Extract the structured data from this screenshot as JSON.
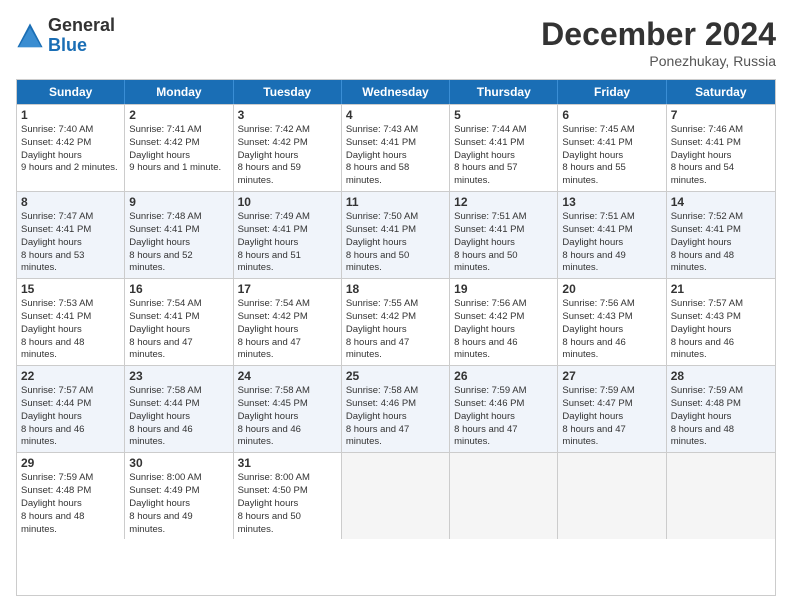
{
  "logo": {
    "general": "General",
    "blue": "Blue"
  },
  "title": "December 2024",
  "location": "Ponezhukay, Russia",
  "days_of_week": [
    "Sunday",
    "Monday",
    "Tuesday",
    "Wednesday",
    "Thursday",
    "Friday",
    "Saturday"
  ],
  "weeks": [
    [
      {
        "day": 1,
        "sunrise": "7:40 AM",
        "sunset": "4:42 PM",
        "daylight": "9 hours and 2 minutes."
      },
      {
        "day": 2,
        "sunrise": "7:41 AM",
        "sunset": "4:42 PM",
        "daylight": "9 hours and 1 minute."
      },
      {
        "day": 3,
        "sunrise": "7:42 AM",
        "sunset": "4:42 PM",
        "daylight": "8 hours and 59 minutes."
      },
      {
        "day": 4,
        "sunrise": "7:43 AM",
        "sunset": "4:41 PM",
        "daylight": "8 hours and 58 minutes."
      },
      {
        "day": 5,
        "sunrise": "7:44 AM",
        "sunset": "4:41 PM",
        "daylight": "8 hours and 57 minutes."
      },
      {
        "day": 6,
        "sunrise": "7:45 AM",
        "sunset": "4:41 PM",
        "daylight": "8 hours and 55 minutes."
      },
      {
        "day": 7,
        "sunrise": "7:46 AM",
        "sunset": "4:41 PM",
        "daylight": "8 hours and 54 minutes."
      }
    ],
    [
      {
        "day": 8,
        "sunrise": "7:47 AM",
        "sunset": "4:41 PM",
        "daylight": "8 hours and 53 minutes."
      },
      {
        "day": 9,
        "sunrise": "7:48 AM",
        "sunset": "4:41 PM",
        "daylight": "8 hours and 52 minutes."
      },
      {
        "day": 10,
        "sunrise": "7:49 AM",
        "sunset": "4:41 PM",
        "daylight": "8 hours and 51 minutes."
      },
      {
        "day": 11,
        "sunrise": "7:50 AM",
        "sunset": "4:41 PM",
        "daylight": "8 hours and 50 minutes."
      },
      {
        "day": 12,
        "sunrise": "7:51 AM",
        "sunset": "4:41 PM",
        "daylight": "8 hours and 50 minutes."
      },
      {
        "day": 13,
        "sunrise": "7:51 AM",
        "sunset": "4:41 PM",
        "daylight": "8 hours and 49 minutes."
      },
      {
        "day": 14,
        "sunrise": "7:52 AM",
        "sunset": "4:41 PM",
        "daylight": "8 hours and 48 minutes."
      }
    ],
    [
      {
        "day": 15,
        "sunrise": "7:53 AM",
        "sunset": "4:41 PM",
        "daylight": "8 hours and 48 minutes."
      },
      {
        "day": 16,
        "sunrise": "7:54 AM",
        "sunset": "4:41 PM",
        "daylight": "8 hours and 47 minutes."
      },
      {
        "day": 17,
        "sunrise": "7:54 AM",
        "sunset": "4:42 PM",
        "daylight": "8 hours and 47 minutes."
      },
      {
        "day": 18,
        "sunrise": "7:55 AM",
        "sunset": "4:42 PM",
        "daylight": "8 hours and 47 minutes."
      },
      {
        "day": 19,
        "sunrise": "7:56 AM",
        "sunset": "4:42 PM",
        "daylight": "8 hours and 46 minutes."
      },
      {
        "day": 20,
        "sunrise": "7:56 AM",
        "sunset": "4:43 PM",
        "daylight": "8 hours and 46 minutes."
      },
      {
        "day": 21,
        "sunrise": "7:57 AM",
        "sunset": "4:43 PM",
        "daylight": "8 hours and 46 minutes."
      }
    ],
    [
      {
        "day": 22,
        "sunrise": "7:57 AM",
        "sunset": "4:44 PM",
        "daylight": "8 hours and 46 minutes."
      },
      {
        "day": 23,
        "sunrise": "7:58 AM",
        "sunset": "4:44 PM",
        "daylight": "8 hours and 46 minutes."
      },
      {
        "day": 24,
        "sunrise": "7:58 AM",
        "sunset": "4:45 PM",
        "daylight": "8 hours and 46 minutes."
      },
      {
        "day": 25,
        "sunrise": "7:58 AM",
        "sunset": "4:46 PM",
        "daylight": "8 hours and 47 minutes."
      },
      {
        "day": 26,
        "sunrise": "7:59 AM",
        "sunset": "4:46 PM",
        "daylight": "8 hours and 47 minutes."
      },
      {
        "day": 27,
        "sunrise": "7:59 AM",
        "sunset": "4:47 PM",
        "daylight": "8 hours and 47 minutes."
      },
      {
        "day": 28,
        "sunrise": "7:59 AM",
        "sunset": "4:48 PM",
        "daylight": "8 hours and 48 minutes."
      }
    ],
    [
      {
        "day": 29,
        "sunrise": "7:59 AM",
        "sunset": "4:48 PM",
        "daylight": "8 hours and 48 minutes."
      },
      {
        "day": 30,
        "sunrise": "8:00 AM",
        "sunset": "4:49 PM",
        "daylight": "8 hours and 49 minutes."
      },
      {
        "day": 31,
        "sunrise": "8:00 AM",
        "sunset": "4:50 PM",
        "daylight": "8 hours and 50 minutes."
      },
      null,
      null,
      null,
      null
    ]
  ]
}
